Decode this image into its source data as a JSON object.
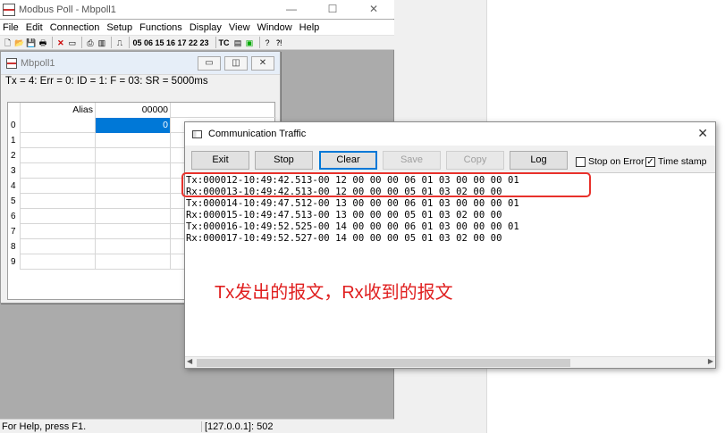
{
  "app": {
    "title": "Modbus Poll - Mbpoll1",
    "window_controls": [
      "—",
      "☐",
      "✕"
    ]
  },
  "menu": [
    "File",
    "Edit",
    "Connection",
    "Setup",
    "Functions",
    "Display",
    "View",
    "Window",
    "Help"
  ],
  "toolbar": {
    "function_codes": "05 06 15 16 17 22 23",
    "tc": "TC"
  },
  "mdi": {
    "title": "Mbpoll1",
    "status_line": "Tx = 4: Err = 0: ID = 1: F = 03: SR = 5000ms",
    "grid": {
      "col_alias": "Alias",
      "col_value": "00000",
      "rows": [
        {
          "idx": "0",
          "value": "0"
        },
        {
          "idx": "1",
          "value": ""
        },
        {
          "idx": "2",
          "value": ""
        },
        {
          "idx": "3",
          "value": ""
        },
        {
          "idx": "4",
          "value": ""
        },
        {
          "idx": "5",
          "value": ""
        },
        {
          "idx": "6",
          "value": ""
        },
        {
          "idx": "7",
          "value": ""
        },
        {
          "idx": "8",
          "value": ""
        },
        {
          "idx": "9",
          "value": ""
        }
      ]
    }
  },
  "statusbar": {
    "help": "For Help, press F1.",
    "connection": "[127.0.0.1]: 502"
  },
  "traffic": {
    "title": "Communication Traffic",
    "buttons": {
      "exit": "Exit",
      "stop": "Stop",
      "clear": "Clear",
      "save": "Save",
      "copy": "Copy",
      "log": "Log"
    },
    "stop_on_error": "Stop on Error",
    "time_stamp": "Time stamp",
    "time_stamp_checked": true,
    "log": [
      "Tx:000012-10:49:42.513-00 12 00 00 00 06 01 03 00 00 00 01",
      "Rx:000013-10:49:42.513-00 12 00 00 00 05 01 03 02 00 00",
      "Tx:000014-10:49:47.512-00 13 00 00 00 06 01 03 00 00 00 01",
      "Rx:000015-10:49:47.513-00 13 00 00 00 05 01 03 02 00 00",
      "Tx:000016-10:49:52.525-00 14 00 00 00 06 01 03 00 00 00 01",
      "Rx:000017-10:49:52.527-00 14 00 00 00 05 01 03 02 00 00"
    ]
  },
  "annotation": "Tx发出的报文，Rx收到的报文",
  "colors": {
    "highlight": "#e8312b",
    "annotation": "#e02020",
    "selection": "#0078d7"
  }
}
